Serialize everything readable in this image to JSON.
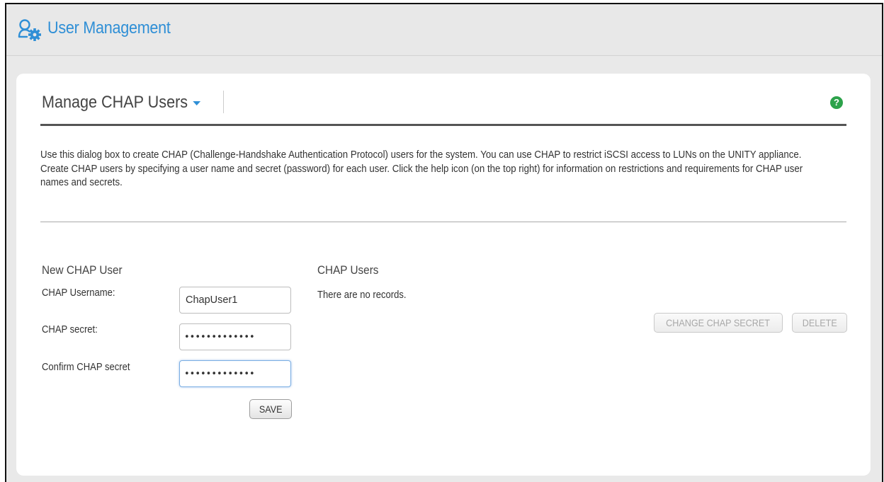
{
  "header": {
    "title": "User Management",
    "icon": "user-settings-icon"
  },
  "panel": {
    "title": "Manage CHAP Users",
    "help_icon_glyph": "?",
    "description": "Use this dialog box to create CHAP (Challenge-Handshake Authentication Protocol) users for the system. You can use CHAP to restrict iSCSI access to LUNs on the UNITY appliance. Create CHAP users by specifying a user name and secret (password) for each user. Click the help icon (on the top right) for information on restrictions and requirements for CHAP user names and secrets."
  },
  "new_user": {
    "heading": "New CHAP User",
    "username_label": "CHAP Username:",
    "username_value": "ChapUser1",
    "secret_label": "CHAP secret:",
    "secret_value": "•••••••••••••",
    "confirm_label": "Confirm CHAP secret",
    "confirm_value": "•••••••••••••",
    "save_label": "SAVE"
  },
  "chap_users": {
    "heading": "CHAP Users",
    "empty_text": "There are no records.",
    "change_secret_label": "CHANGE CHAP SECRET",
    "delete_label": "DELETE"
  },
  "colors": {
    "accent": "#2f8fd6",
    "help": "#2ca24a"
  }
}
